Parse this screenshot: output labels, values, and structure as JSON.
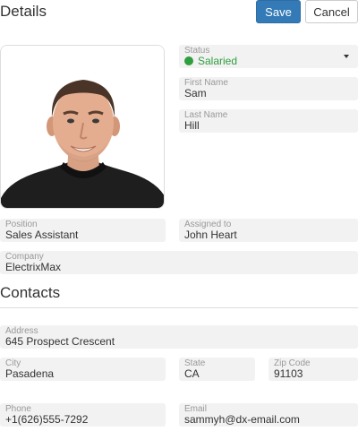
{
  "header": {
    "title": "Details",
    "save_label": "Save",
    "cancel_label": "Cancel"
  },
  "status": {
    "label": "Status",
    "value": "Salaried",
    "color": "#2e9e3e"
  },
  "first_name": {
    "label": "First Name",
    "value": "Sam"
  },
  "last_name": {
    "label": "Last Name",
    "value": "Hill"
  },
  "position": {
    "label": "Position",
    "value": "Sales Assistant"
  },
  "assigned_to": {
    "label": "Assigned to",
    "value": "John Heart"
  },
  "company": {
    "label": "Company",
    "value": "ElectrixMax"
  },
  "contacts": {
    "title": "Contacts",
    "address": {
      "label": "Address",
      "value": "645 Prospect Crescent"
    },
    "city": {
      "label": "City",
      "value": "Pasadena"
    },
    "state": {
      "label": "State",
      "value": "CA"
    },
    "zip": {
      "label": "Zip Code",
      "value": "91103"
    },
    "phone": {
      "label": "Phone",
      "value": "+1(626)555-7292"
    },
    "email": {
      "label": "Email",
      "value": "sammyh@dx-email.com"
    }
  },
  "colors": {
    "accent": "#337ab7",
    "field_bg": "#f2f2f2",
    "label": "#999999"
  }
}
